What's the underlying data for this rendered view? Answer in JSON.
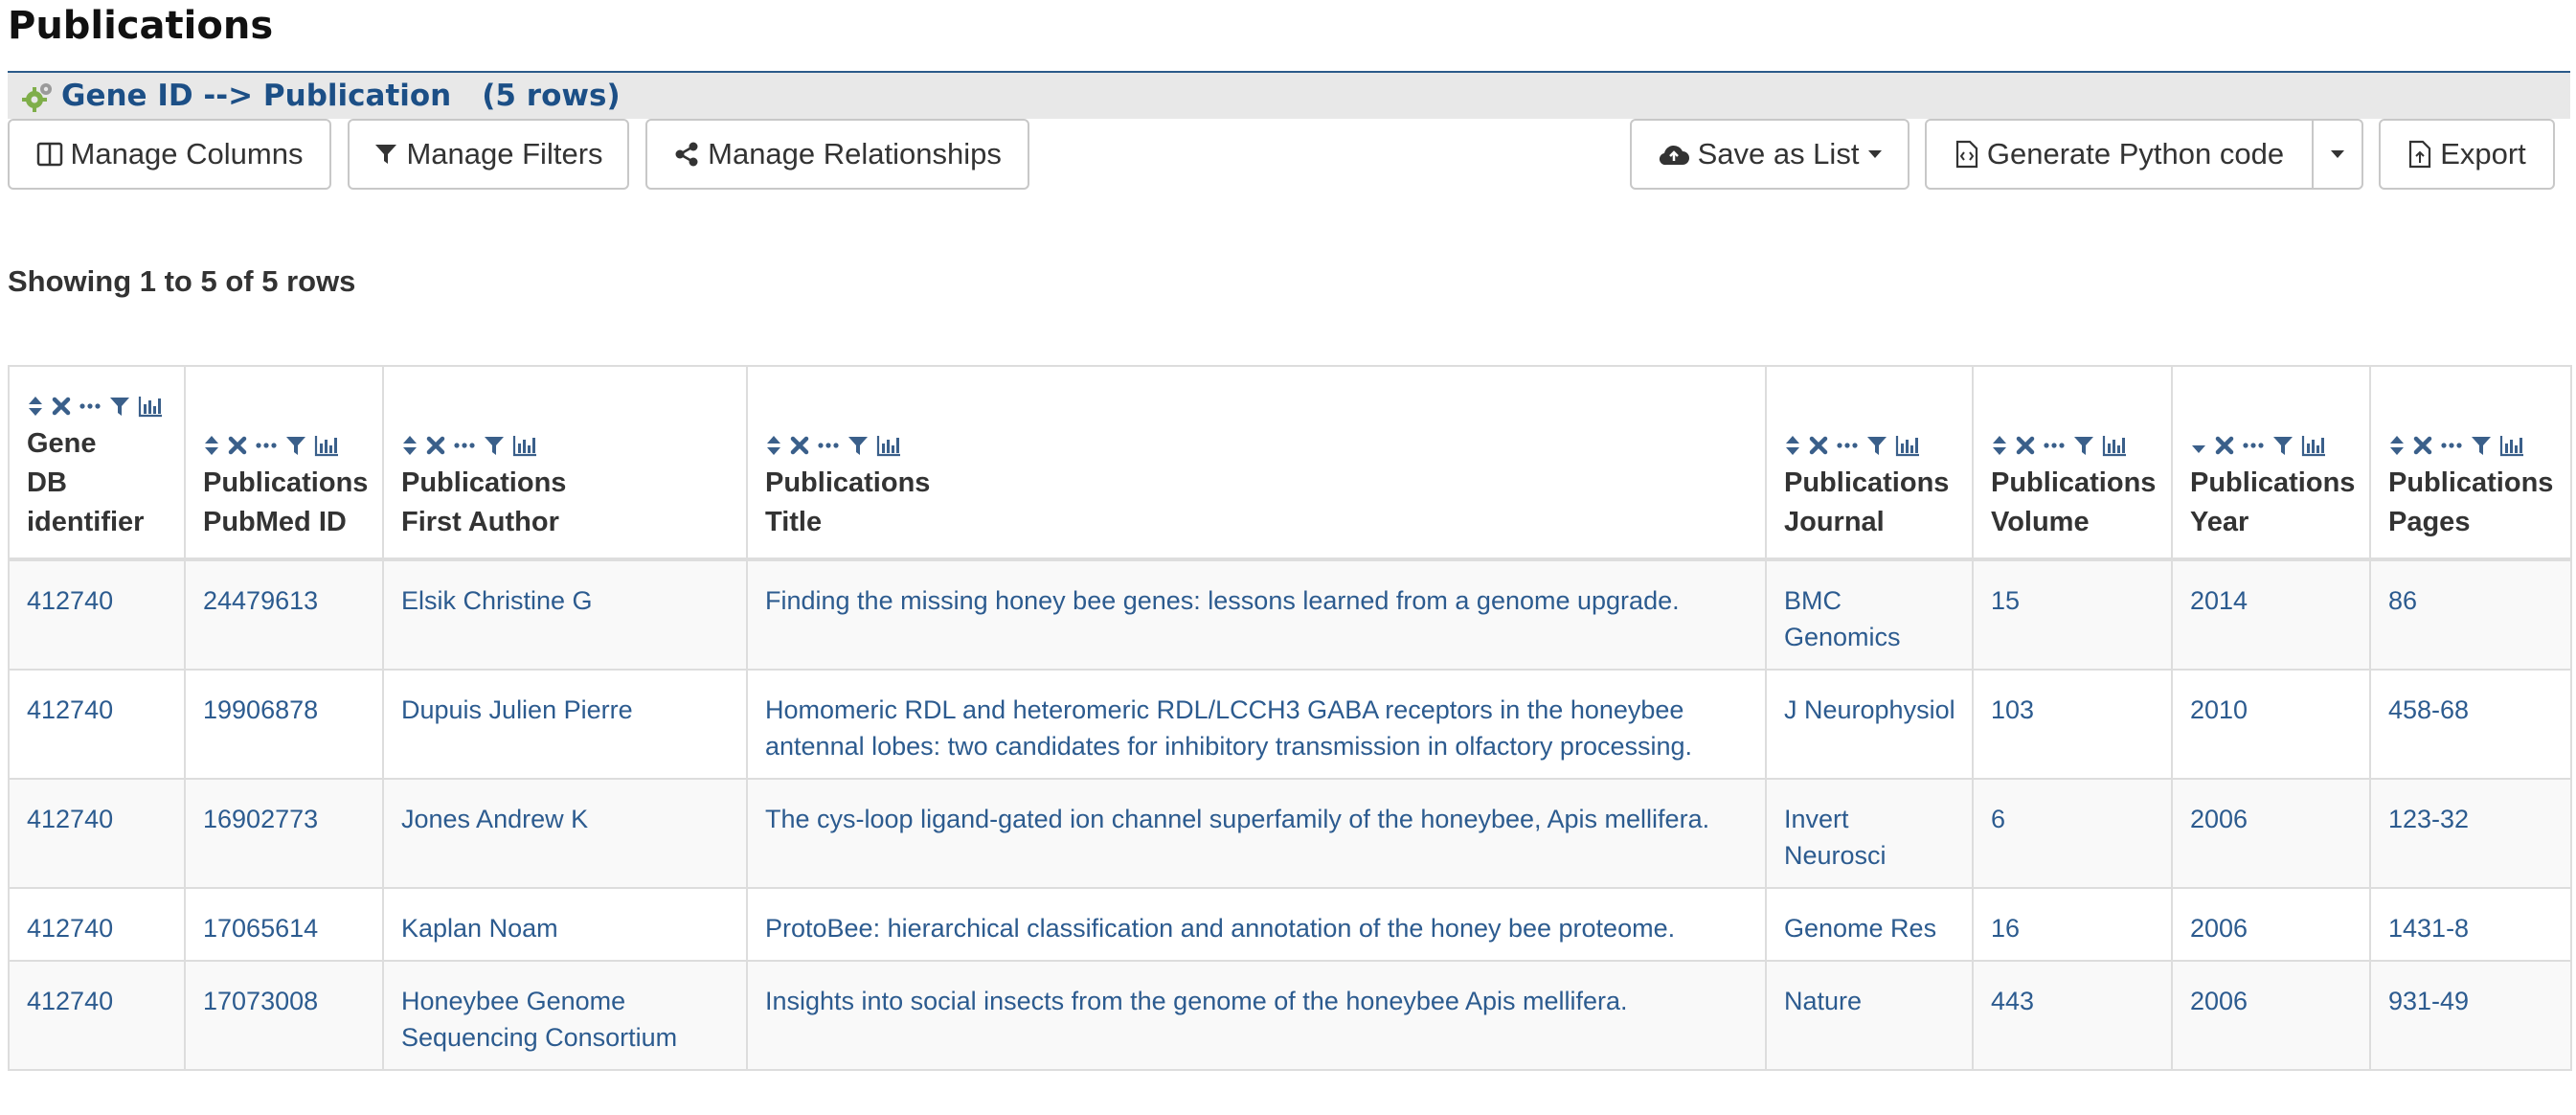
{
  "page": {
    "title": "Publications"
  },
  "query": {
    "path": "Gene ID --> Publication",
    "count": "(5 rows)"
  },
  "toolbar": {
    "manage_columns": "Manage Columns",
    "manage_filters": "Manage Filters",
    "manage_relationships": "Manage Relationships",
    "save_as_list": "Save as List",
    "generate_python": "Generate Python code",
    "export": "Export"
  },
  "status": {
    "showing": "Showing 1 to 5 of 5 rows"
  },
  "table": {
    "columns": [
      {
        "line1": "Gene",
        "line2": "DB",
        "line3": "identifier"
      },
      {
        "line1": "Publications",
        "line2": "PubMed ID"
      },
      {
        "line1": "Publications",
        "line2": "First Author"
      },
      {
        "line1": "Publications",
        "line2": "Title"
      },
      {
        "line1": "Publications",
        "line2": "Journal"
      },
      {
        "line1": "Publications",
        "line2": "Volume"
      },
      {
        "line1": "Publications",
        "line2": "Year"
      },
      {
        "line1": "Publications",
        "line2": "Pages"
      }
    ],
    "rows": [
      [
        "412740",
        "24479613",
        "Elsik Christine G",
        "Finding the missing honey bee genes: lessons learned from a genome upgrade.",
        "BMC Genomics",
        "15",
        "2014",
        "86"
      ],
      [
        "412740",
        "19906878",
        "Dupuis Julien Pierre",
        "Homomeric RDL and heteromeric RDL/LCCH3 GABA receptors in the honeybee antennal lobes: two candidates for inhibitory transmission in olfactory processing.",
        "J Neurophysiol",
        "103",
        "2010",
        "458-68"
      ],
      [
        "412740",
        "16902773",
        "Jones Andrew K",
        "The cys-loop ligand-gated ion channel superfamily of the honeybee, Apis mellifera.",
        "Invert Neurosci",
        "6",
        "2006",
        "123-32"
      ],
      [
        "412740",
        "17065614",
        "Kaplan Noam",
        "ProtoBee: hierarchical classification and annotation of the honey bee proteome.",
        "Genome Res",
        "16",
        "2006",
        "1431-8"
      ],
      [
        "412740",
        "17073008",
        "Honeybee Genome Sequencing Consortium",
        "Insights into social insects from the genome of the honeybee Apis mellifera.",
        "Nature",
        "443",
        "2006",
        "931-49"
      ]
    ]
  },
  "colors": {
    "accent": "#1c4f86",
    "link": "#2c5b8f",
    "icon": "#3a5f8a"
  }
}
